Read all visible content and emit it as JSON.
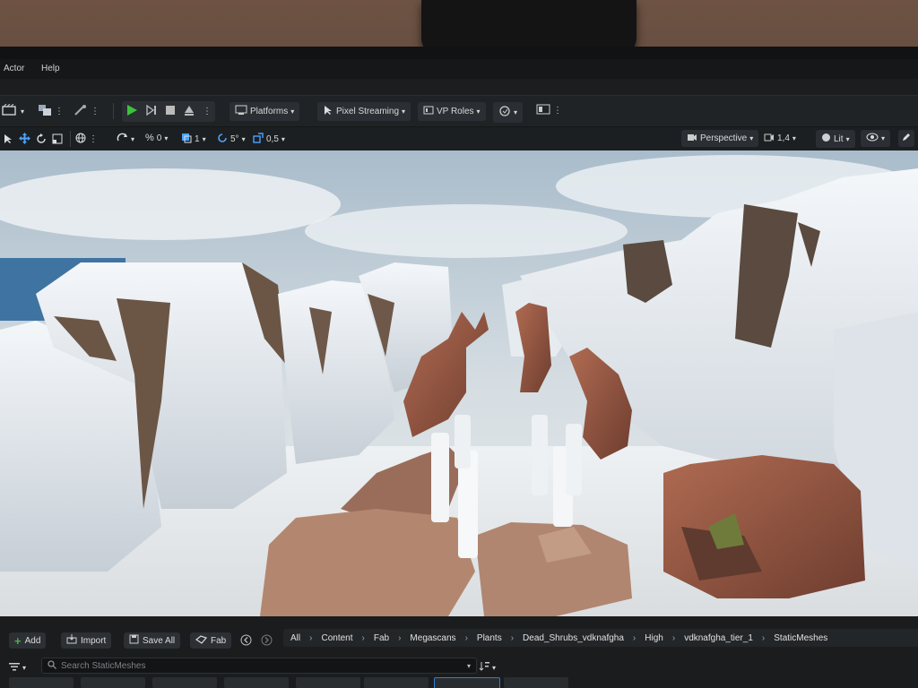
{
  "menu": {
    "items": [
      "Actor",
      "Help"
    ]
  },
  "toolbar": {
    "platforms_label": "Platforms",
    "pixel_streaming_label": "Pixel Streaming",
    "vp_roles_label": "VP Roles",
    "rotation_snap_value": "0",
    "surface_snap_value": "1",
    "angle_snap_value": "5°",
    "scale_snap_value": "0,5",
    "perspective_label": "Perspective",
    "camera_speed_value": "1,4",
    "lit_label": "Lit"
  },
  "content_browser": {
    "add_label": "Add",
    "import_label": "Import",
    "save_all_label": "Save All",
    "fab_label": "Fab",
    "breadcrumbs": [
      "All",
      "Content",
      "Fab",
      "Megascans",
      "Plants",
      "Dead_Shrubs_vdknafgha",
      "High",
      "vdknafgha_tier_1",
      "StaticMeshes"
    ],
    "search_placeholder": "Search StaticMeshes"
  },
  "colors": {
    "play_green": "#3cc23c",
    "add_green": "#4caf50",
    "selected_thumb": "#2f7fd6"
  }
}
